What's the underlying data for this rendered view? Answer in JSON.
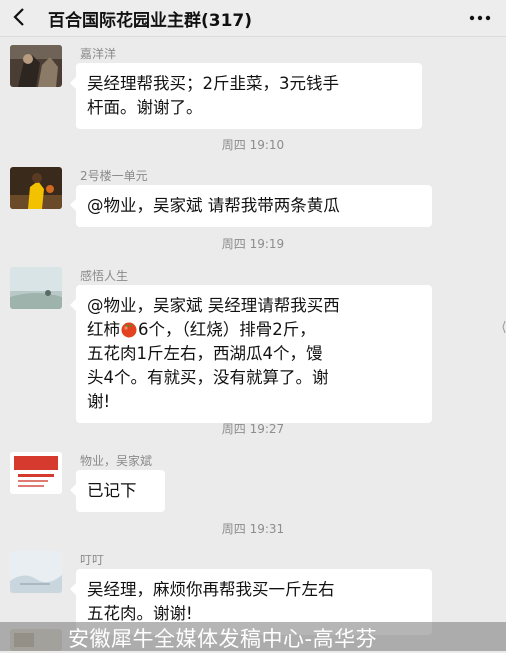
{
  "header": {
    "title": "百合国际花园业主群(317)",
    "back_icon": "chevron-left-icon",
    "more_icon": "more-horizontal-icon"
  },
  "messages": [
    {
      "sender": "嘉洋洋",
      "lines": [
        "吴经理帮我买；2斤韭菜，3元钱手",
        "杆面。谢谢了。"
      ]
    },
    {
      "timestamp": "周四 19:10"
    },
    {
      "sender": "2号楼一单元",
      "lines": [
        "@物业，吴家斌  请帮我带两条黄瓜"
      ]
    },
    {
      "timestamp": "周四 19:19"
    },
    {
      "sender": "感悟人生",
      "lines": [
        "@物业，吴家斌  吴经理请帮我买西",
        "红柿",
        "6个，（红烧）排骨2斤，",
        "五花肉1斤左右，西湖瓜4个，馒",
        "头4个。有就买，没有就算了。谢",
        "谢!"
      ]
    },
    {
      "timestamp": "周四 19:27"
    },
    {
      "sender": "物业，吴家斌",
      "lines": [
        "已记下"
      ]
    },
    {
      "timestamp": "周四 19:31"
    },
    {
      "sender": "叮叮",
      "lines": [
        "吴经理，麻烦你再帮我买一斤左右",
        "五花肉。谢谢!"
      ]
    }
  ],
  "watermark": "安徽犀牛全媒体发稿中心-高华芬",
  "colors": {
    "background": "#ebebeb",
    "bubble": "#ffffff",
    "timestamp_text": "#8d8d8d",
    "sender_text": "#8a8a8a"
  }
}
